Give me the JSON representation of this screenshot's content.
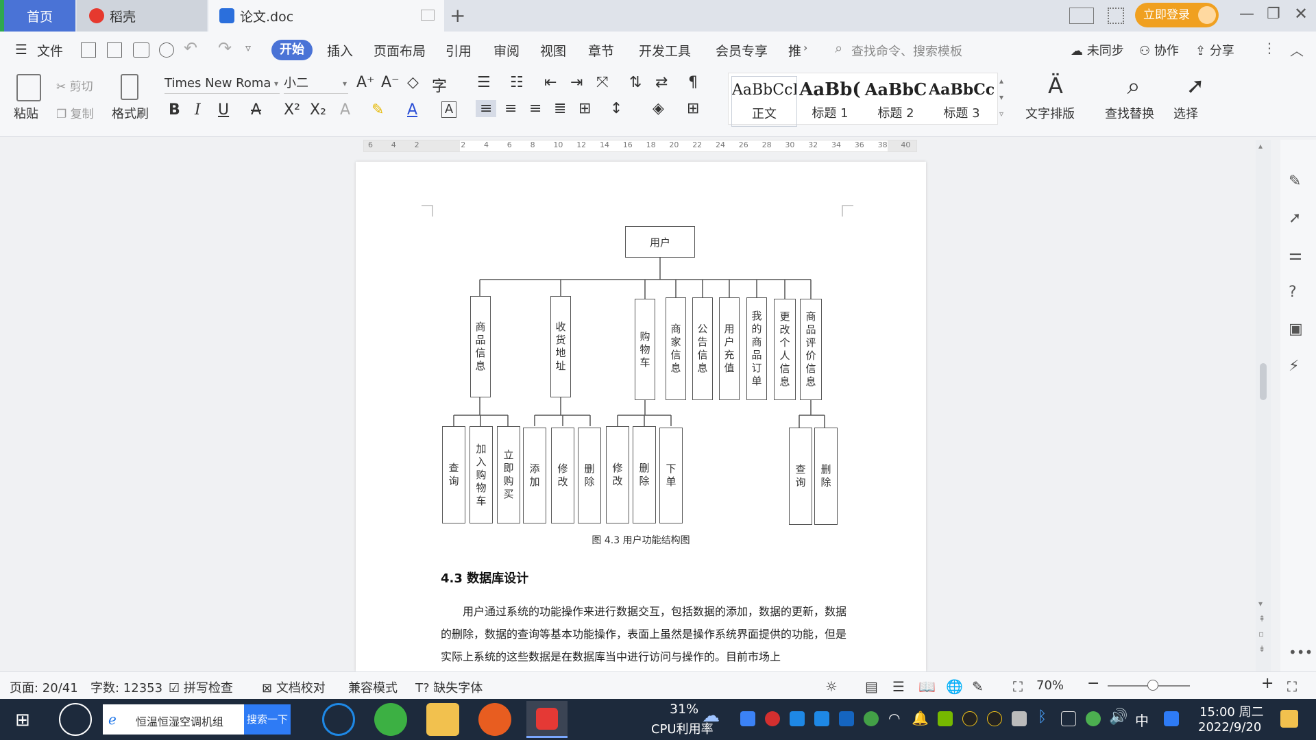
{
  "tabs": {
    "home": "首页",
    "daoke": "稻壳",
    "doc": "论文.doc",
    "login": "立即登录"
  },
  "menu": {
    "file": "文件",
    "items": [
      "开始",
      "插入",
      "页面布局",
      "引用",
      "审阅",
      "视图",
      "章节",
      "开发工具",
      "会员专享",
      "推"
    ],
    "search_placeholder": "查找命令、搜索模板",
    "sync": "未同步",
    "collab": "协作",
    "share": "分享"
  },
  "ribbon": {
    "paste": "粘贴",
    "cut": "剪切",
    "copy": "复制",
    "format_painter": "格式刷",
    "font_name": "Times New Roma",
    "font_size": "小二",
    "styles": [
      {
        "preview": "AaBbCcI",
        "label": "正文"
      },
      {
        "preview": "AaBb(",
        "label": "标题 1"
      },
      {
        "preview": "AaBbC",
        "label": "标题 2"
      },
      {
        "preview": "AaBbCcl",
        "label": "标题 3"
      }
    ],
    "text_layout": "文字排版",
    "find_replace": "查找替换",
    "select": "选择"
  },
  "ruler": {
    "ticks": [
      "6",
      "4",
      "2",
      "",
      "2",
      "4",
      "6",
      "8",
      "10",
      "12",
      "14",
      "16",
      "18",
      "20",
      "22",
      "24",
      "26",
      "28",
      "30",
      "32",
      "34",
      "36",
      "38",
      "40"
    ]
  },
  "diagram": {
    "root": "用户",
    "level1": [
      "商品信息",
      "收货地址",
      "购物车",
      "商家信息",
      "公告信息",
      "用户充值",
      "我的商品订单",
      "更改个人信息",
      "商品评价信息"
    ],
    "level2": [
      "查询",
      "加入购物车",
      "立即购买",
      "添加",
      "修改",
      "删除",
      "修改",
      "删除",
      "下单",
      "查询",
      "删除"
    ],
    "caption": "图 4.3  用户功能结构图"
  },
  "document": {
    "heading": "4.3  数据库设计",
    "body": "用户通过系统的功能操作来进行数据交互，包括数据的添加，数据的更新，数据的删除，数据的查询等基本功能操作，表面上虽然是操作系统界面提供的功能，但是实际上系统的这些数据是在数据库当中进行访问与操作的。目前市场上"
  },
  "status": {
    "page": "页面: 20/41",
    "words": "字数: 12353",
    "spell": "拼写检查",
    "proof": "文档校对",
    "compat": "兼容模式",
    "missing_font": "缺失字体",
    "zoom": "70%"
  },
  "taskbar": {
    "search_text": "恒温恒湿空调机组",
    "search_button": "搜索一下",
    "cpu_percent": "31%",
    "cpu_label": "CPU利用率",
    "ime": "中",
    "time": "15:00 周二",
    "date": "2022/9/20"
  },
  "colors": {
    "accent": "#4a73d6",
    "login": "#f0a020",
    "taskbar": "#1d2a3c"
  }
}
